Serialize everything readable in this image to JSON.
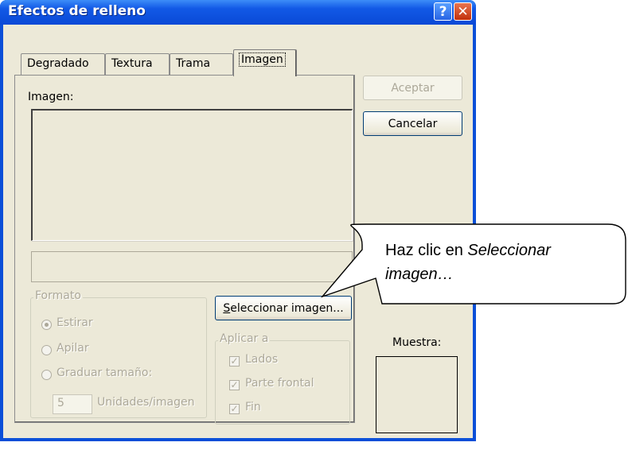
{
  "window": {
    "title": "Efectos de relleno",
    "help_icon": "question-icon",
    "close_icon": "close-icon",
    "titlebar_color": "#0a49d6"
  },
  "tabs": [
    {
      "label": "Degradado",
      "active": false
    },
    {
      "label": "Textura",
      "active": false
    },
    {
      "label": "Trama",
      "active": false
    },
    {
      "label": "Imagen",
      "active": true
    }
  ],
  "panel": {
    "image_label": "Imagen:",
    "format_group": {
      "legend": "Formato",
      "options": [
        {
          "label": "Estirar",
          "checked": true
        },
        {
          "label": "Apilar",
          "checked": false
        },
        {
          "label": "Graduar tamaño:",
          "checked": false
        }
      ],
      "units_value": "5",
      "units_label": "Unidades/imagen"
    },
    "select_button": {
      "prefix": "S",
      "rest": "eleccionar imagen..."
    },
    "apply_group": {
      "legend": "Aplicar a",
      "options": [
        {
          "label": "Lados",
          "checked": true
        },
        {
          "label": "Parte frontal",
          "checked": true
        },
        {
          "label": "Fin",
          "checked": true
        }
      ]
    }
  },
  "buttons": {
    "ok": "Aceptar",
    "cancel": "Cancelar"
  },
  "sample_label": "Muestra:",
  "callout": {
    "text_prefix": "Haz clic en ",
    "text_italic_1": "Seleccionar",
    "text_italic_2": "imagen…"
  }
}
